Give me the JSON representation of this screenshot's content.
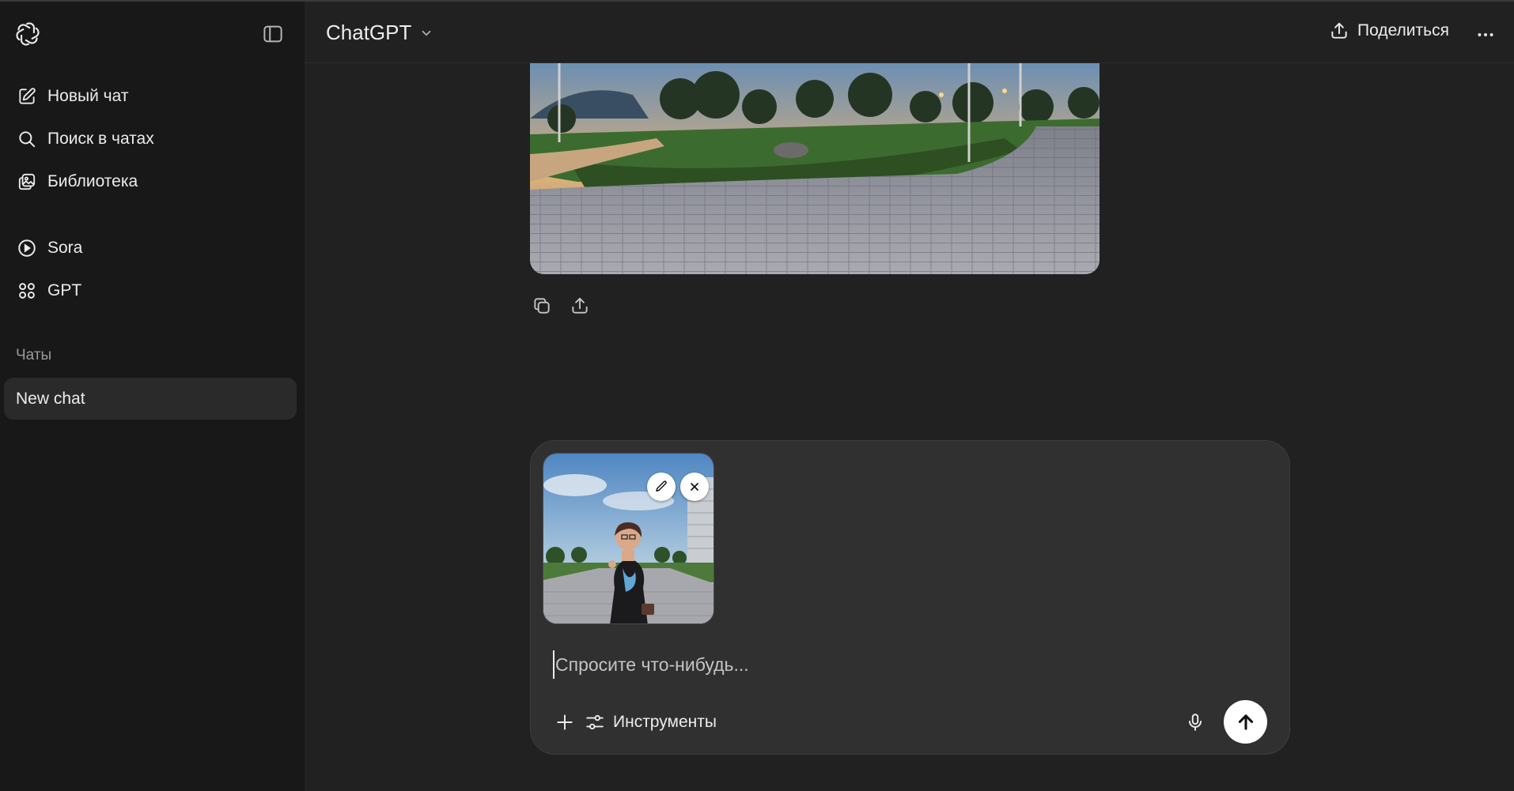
{
  "app": {
    "model_name": "ChatGPT"
  },
  "sidebar": {
    "items": [
      {
        "label": "Новый чат",
        "icon": "new-chat-icon"
      },
      {
        "label": "Поиск в чатах",
        "icon": "search-icon"
      },
      {
        "label": "Библиотека",
        "icon": "library-icon"
      },
      {
        "label": "Sora",
        "icon": "play-circle-icon"
      },
      {
        "label": "GPT",
        "icon": "grid-icon"
      }
    ],
    "section_label": "Чаты",
    "chats": [
      {
        "title": "New chat"
      }
    ]
  },
  "header": {
    "share_label": "Поделиться"
  },
  "composer": {
    "placeholder": "Спросите что-нибудь...",
    "tools_label": "Инструменты"
  },
  "colors": {
    "sidebar_bg": "#181818",
    "main_bg": "#212121",
    "composer_bg": "#303030",
    "text": "#ececec",
    "muted": "#9b9b9b"
  }
}
